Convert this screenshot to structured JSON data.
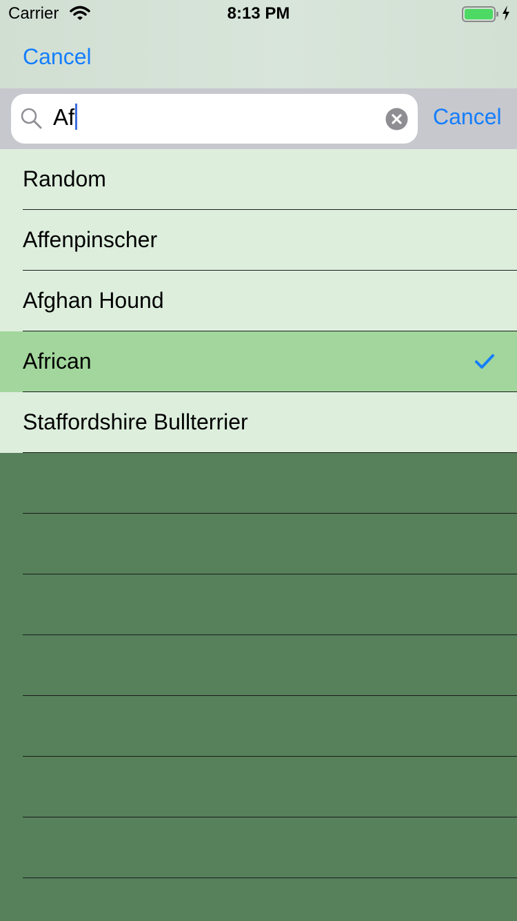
{
  "status_bar": {
    "carrier": "Carrier",
    "time": "8:13 PM",
    "icons": [
      "wifi-icon",
      "battery-icon",
      "charging-bolt-icon"
    ]
  },
  "nav": {
    "cancel_label": "Cancel"
  },
  "search": {
    "value": "Af",
    "cancel_label": "Cancel",
    "icons": [
      "search-icon",
      "clear-icon"
    ]
  },
  "list": {
    "items": [
      {
        "label": "Random",
        "selected": false
      },
      {
        "label": "Affenpinscher",
        "selected": false
      },
      {
        "label": "Afghan Hound",
        "selected": false
      },
      {
        "label": "African",
        "selected": true
      },
      {
        "label": "Staffordshire Bullterrier",
        "selected": false
      }
    ],
    "empty_rows": 7,
    "selected_icon": "checkmark-icon"
  },
  "colors": {
    "accent": "#157efb",
    "row_background": "#ddeedd",
    "selected_row_background": "#a2d69c",
    "empty_area": "#56815b",
    "search_bar_background": "#c7c8cd"
  }
}
